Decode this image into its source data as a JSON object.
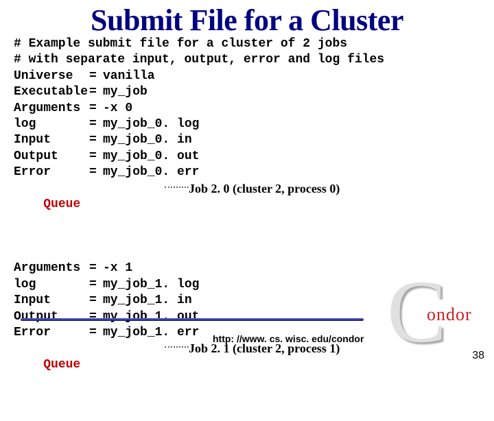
{
  "title": "Submit File for a Cluster",
  "code": {
    "comment1": "# Example submit file for a cluster of 2 jobs",
    "comment2": "# with separate input, output, error and log files",
    "rows0": [
      {
        "k": "Universe",
        "v": "vanilla"
      },
      {
        "k": "Executable",
        "v": "my_job"
      },
      {
        "k": "Arguments",
        "v": "-x 0"
      },
      {
        "k": "log",
        "v": "my_job_0. log"
      },
      {
        "k": "Input",
        "v": "my_job_0. in"
      },
      {
        "k": "Output",
        "v": "my_job_0. out"
      },
      {
        "k": "Error",
        "v": "my_job_0. err"
      }
    ],
    "queue0": "Queue",
    "anno0": "Job 2. 0 (cluster 2, process 0)",
    "rows1": [
      {
        "k": "Arguments",
        "v": "-x 1"
      },
      {
        "k": "log",
        "v": "my_job_1. log"
      },
      {
        "k": "Input",
        "v": "my_job_1. in"
      },
      {
        "k": "Output",
        "v": "my_job_1. out"
      },
      {
        "k": "Error",
        "v": "my_job_1. err"
      }
    ],
    "queue1": "Queue",
    "anno1": "Job 2. 1 (cluster 2, process 1)"
  },
  "footer": {
    "url": "http: //www. cs. wisc. edu/condor",
    "page": "38"
  },
  "logo": {
    "c": "C",
    "text": "ondor"
  }
}
